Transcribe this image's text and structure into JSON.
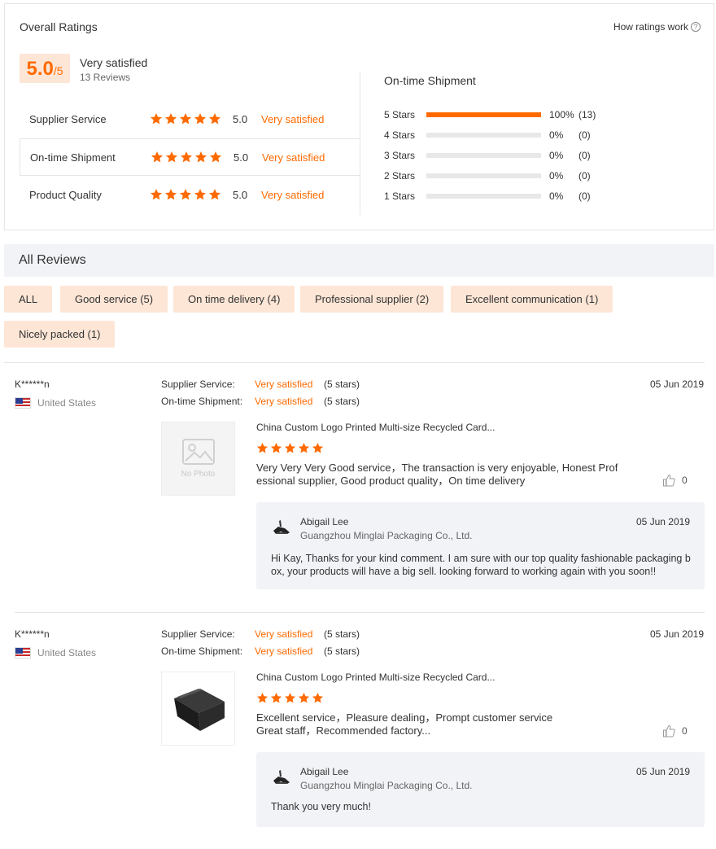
{
  "overall": {
    "title": "Overall Ratings",
    "how_ratings": "How ratings work",
    "score": "5.0",
    "score_max": "/5",
    "satisfaction": "Very satisfied",
    "review_count": "13 Reviews",
    "categories": [
      {
        "label": "Supplier Service",
        "stars": 5,
        "score": "5.0",
        "text": "Very satisfied"
      },
      {
        "label": "On-time Shipment",
        "stars": 5,
        "score": "5.0",
        "text": "Very satisfied"
      },
      {
        "label": "Product Quality",
        "stars": 5,
        "score": "5.0",
        "text": "Very satisfied"
      }
    ]
  },
  "shipment": {
    "title": "On-time Shipment",
    "rows": [
      {
        "label": "5  Stars",
        "fill": 1.0,
        "pct": "100%",
        "count": "(13)"
      },
      {
        "label": "4  Stars",
        "fill": 0,
        "pct": "0%",
        "count": "(0)"
      },
      {
        "label": "3  Stars",
        "fill": 0,
        "pct": "0%",
        "count": "(0)"
      },
      {
        "label": "2  Stars",
        "fill": 0,
        "pct": "0%",
        "count": "(0)"
      },
      {
        "label": "1  Stars",
        "fill": 0,
        "pct": "0%",
        "count": "(0)"
      }
    ]
  },
  "all_reviews": {
    "title": "All Reviews",
    "tags": [
      "ALL",
      "Good service (5)",
      "On time delivery (4)",
      "Professional supplier (2)",
      "Excellent communication (1)",
      "Nicely packed (1)"
    ]
  },
  "reviews": [
    {
      "reviewer": "K******n",
      "country": "United States",
      "date": "05 Jun 2019",
      "criteria": [
        {
          "key": "Supplier Service:",
          "value": "Very satisfied",
          "stars": "(5 stars)"
        },
        {
          "key": "On-time Shipment:",
          "value": "Very satisfied",
          "stars": "(5 stars)"
        }
      ],
      "photo_text": "No Photo",
      "product_title": "China Custom Logo Printed Multi-size Recycled Card...",
      "rating": 5,
      "comment": "Very Very Very Good service，The transaction is very enjoyable, Honest Professional supplier, Good product quality，On time delivery",
      "likes": "0",
      "reply": {
        "name": "Abigail Lee",
        "company": "Guangzhou Minglai Packaging Co., Ltd.",
        "date": "05 Jun 2019",
        "text": "Hi Kay, Thanks for your kind comment. I am sure  with our top quality fashionable packaging box, your products will have a big sell. looking forward to working again with you soon!!"
      }
    },
    {
      "reviewer": "K******n",
      "country": "United States",
      "date": "05 Jun 2019",
      "criteria": [
        {
          "key": "Supplier Service:",
          "value": "Very satisfied",
          "stars": "(5 stars)"
        },
        {
          "key": "On-time Shipment:",
          "value": "Very satisfied",
          "stars": "(5 stars)"
        }
      ],
      "product_title": "China Custom Logo Printed Multi-size Recycled Card...",
      "rating": 5,
      "comment_lines": [
        "Excellent service，Pleasure dealing，Prompt customer service",
        "Great staff，Recommended factory..."
      ],
      "likes": "0",
      "reply": {
        "name": "Abigail Lee",
        "company": "Guangzhou Minglai Packaging Co., Ltd.",
        "date": "05 Jun 2019",
        "text": "Thank you very much!"
      }
    }
  ],
  "colors": {
    "accent": "#ff6a00",
    "tag_bg": "#fde6d6",
    "panel_bg": "#f2f3f7"
  }
}
